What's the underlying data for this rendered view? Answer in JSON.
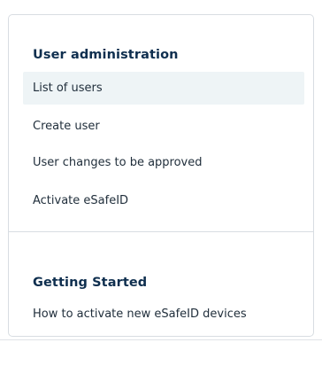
{
  "sections": [
    {
      "title": "User administration",
      "items": [
        {
          "label": "List of users",
          "active": true
        },
        {
          "label": "Create user",
          "active": false
        },
        {
          "label": "User changes to be approved",
          "active": false
        },
        {
          "label": "Activate eSafeID",
          "active": false
        }
      ]
    },
    {
      "title": "Getting Started",
      "items": [
        {
          "label": "How to activate new eSafeID devices"
        }
      ]
    }
  ],
  "colors": {
    "heading": "#0f2f4f",
    "text": "#1f2d3a",
    "active_background": "#eef4f6",
    "border": "#d8dde2"
  }
}
